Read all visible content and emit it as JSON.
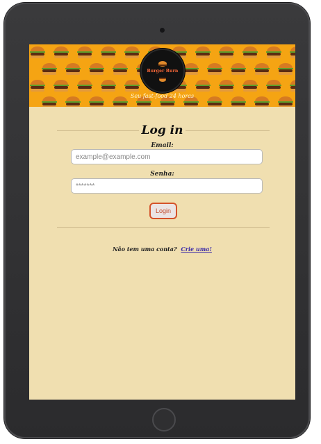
{
  "brand": {
    "logo_text": "Burger Burn",
    "tagline": "Seu fast-food 24 horas"
  },
  "login": {
    "title": "Log in",
    "email_label": "Email:",
    "email_placeholder": "example@example.com",
    "password_label": "Senha:",
    "password_placeholder": "*******",
    "submit_label": "Login"
  },
  "signup": {
    "prompt": "Não tem uma conta?",
    "link_label": "Crie uma!"
  },
  "colors": {
    "banner": "#f5a413",
    "page_background": "#f0dfb0",
    "button_border": "#d4532a",
    "link": "#3a2aa8"
  },
  "icons": [
    "burger-icon",
    "camera-icon",
    "home-button-icon"
  ]
}
